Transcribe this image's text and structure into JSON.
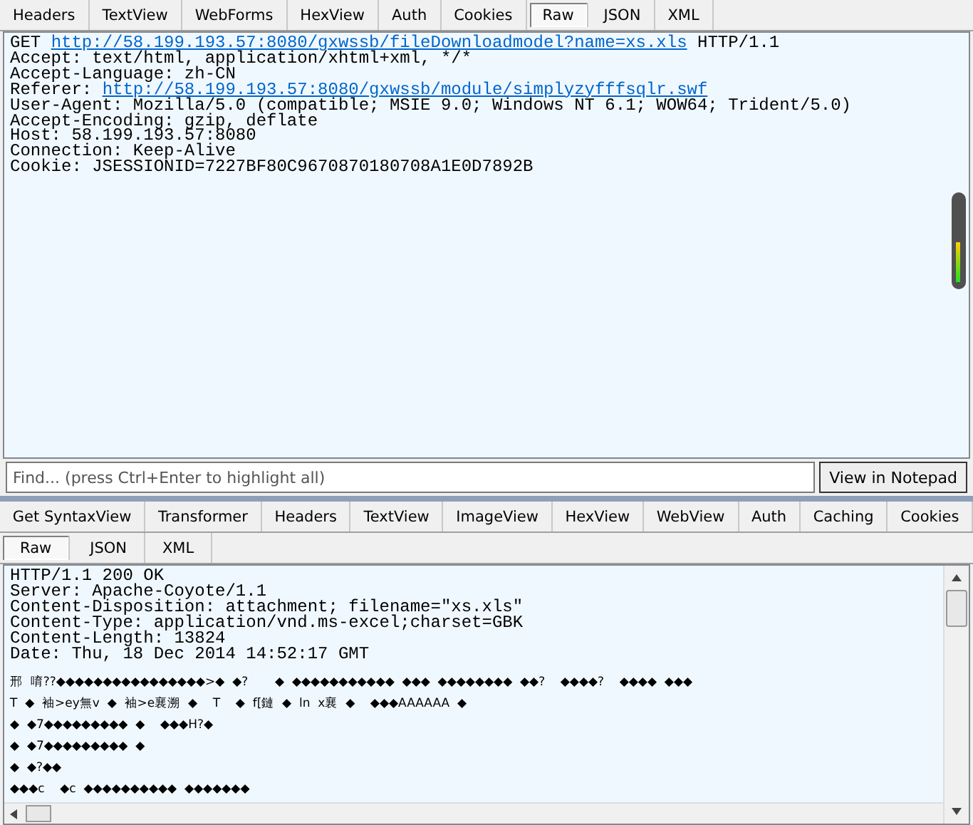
{
  "request_tabs": [
    {
      "label": "Headers",
      "selected": false
    },
    {
      "label": "TextView",
      "selected": false
    },
    {
      "label": "WebForms",
      "selected": false
    },
    {
      "label": "HexView",
      "selected": false
    },
    {
      "label": "Auth",
      "selected": false
    },
    {
      "label": "Cookies",
      "selected": false
    },
    {
      "label": "Raw",
      "selected": true
    },
    {
      "label": "JSON",
      "selected": false
    },
    {
      "label": "XML",
      "selected": false
    }
  ],
  "request_lines": [
    {
      "kind": "link",
      "prefix": "GET ",
      "url": "http://58.199.193.57:8080/gxwssb/fileDownloadmodel?name=xs.xls",
      "suffix": " HTTP/1.1"
    },
    {
      "kind": "plain",
      "text": "Accept: text/html, application/xhtml+xml, */*"
    },
    {
      "kind": "plain",
      "text": "Accept-Language: zh-CN"
    },
    {
      "kind": "link",
      "prefix": "Referer: ",
      "url": "http://58.199.193.57:8080/gxwssb/module/simplyzyfffsqlr.swf"
    },
    {
      "kind": "plain",
      "text": "User-Agent: Mozilla/5.0 (compatible; MSIE 9.0; Windows NT 6.1; WOW64; Trident/5.0)"
    },
    {
      "kind": "plain",
      "text": "Accept-Encoding: gzip, deflate"
    },
    {
      "kind": "plain",
      "text": "Host: 58.199.193.57:8080"
    },
    {
      "kind": "plain",
      "text": "Connection: Keep-Alive"
    },
    {
      "kind": "plain",
      "text": "Cookie: JSESSIONID=7227BF80C9670870180708A1E0D7892B"
    }
  ],
  "find_bar": {
    "placeholder": "Find... (press Ctrl+Enter to highlight all)",
    "button": "View in Notepad"
  },
  "response_tabs_row_1": [
    {
      "label": "Get SyntaxView",
      "selected": false
    },
    {
      "label": "Transformer",
      "selected": false
    },
    {
      "label": "Headers",
      "selected": false
    },
    {
      "label": "TextView",
      "selected": false
    },
    {
      "label": "ImageView",
      "selected": false
    },
    {
      "label": "HexView",
      "selected": false
    },
    {
      "label": "WebView",
      "selected": false
    },
    {
      "label": "Auth",
      "selected": false
    },
    {
      "label": "Caching",
      "selected": false
    },
    {
      "label": "Cookies",
      "selected": false
    }
  ],
  "response_tabs_row_2": [
    {
      "label": "Raw",
      "selected": true
    },
    {
      "label": "JSON",
      "selected": false
    },
    {
      "label": "XML",
      "selected": false
    }
  ],
  "response_lines": [
    "HTTP/1.1 200 OK",
    "Server: Apache-Coyote/1.1",
    "Content-Disposition: attachment; filename=\"xs.xls\"",
    "Content-Type: application/vnd.ms-excel;charset=GBK",
    "Content-Length: 13824",
    "Date: Thu, 18 Dec 2014 14:52:17 GMT"
  ],
  "response_body_lines": [
    "邢  唷??◆◆◆◆◆◆◆◆◆◆◆◆◆◆◆◆>◆  ◆?       ◆  ◆◆◆◆◆◆◆◆◆◆◆  ◆◆◆  ◆◆◆◆◆◆◆◆  ◆◆?    ◆◆◆◆?    ◆◆◆◆  ◆◆◆",
    "T  ◆  袖>ey無v  ◆  袖>e襄溯  ◆    T    ◆  f[鏈  ◆  ln  x襄  ◆    ◆◆◆AAAAAA  ◆",
    "◆  ◆7◆◆◆◆◆◆◆◆◆  ◆    ◆◆◆H?◆",
    "◆  ◆7◆◆◆◆◆◆◆◆◆  ◆",
    "◆  ◆?◆◆",
    "◆◆◆c    ◆c  ◆◆◆◆◆◆◆◆◆◆  ◆◆◆◆◆◆◆"
  ]
}
